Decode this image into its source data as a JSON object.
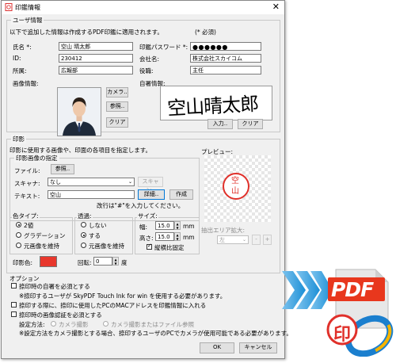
{
  "window": {
    "title": "印鑑情報",
    "close": "✕"
  },
  "user": {
    "group": "ユーザ情報",
    "instruction": "以下で追加した情報は作成するPDF印鑑に適用されます。",
    "required_note": "(* 必須)",
    "name_label": "氏名 *:",
    "name_value": "空山 晴太郎",
    "password_label": "印鑑パスワード *:",
    "password_value": "●●●●●●",
    "id_label": "ID:",
    "id_value": "230412",
    "company_label": "会社名:",
    "company_value": "株式会社スカイコム",
    "dept_label": "所属:",
    "dept_value": "広報部",
    "title_label": "役職:",
    "title_value": "主任",
    "image_label": "画像情報:",
    "camera_btn": "カメラ..",
    "browse_btn": "参照..",
    "clear_btn": "クリア",
    "signature_label": "自署情報:",
    "signature_text": "空山晴太郎",
    "input_btn": "入力..",
    "sig_clear_btn": "クリア"
  },
  "seal": {
    "group": "印影",
    "instruction": "印影に使用する画像や、印面の各項目を指定します。",
    "spec_group": "印影画像の指定",
    "file_label": "ファイル:",
    "file_browse": "参照..",
    "scanner_label": "スキャナ:",
    "scanner_value": "なし",
    "scan_btn": "スキャン..",
    "text_label": "テキスト:",
    "text_value": "空山",
    "detail_btn": "詳細..",
    "create_btn": "作成",
    "newline_note": "改行は\"#\"を入力してください。",
    "preview_label": "プレビュー:",
    "preview_text": "空山",
    "extract_label": "抽出エリア拡大:",
    "extract_value": "左",
    "extract_minus": "-",
    "extract_plus": "+",
    "color_type_label": "色タイプ:",
    "color_opts": [
      "2値",
      "グラデーション",
      "元画像を維持"
    ],
    "transparent_label": "透過:",
    "transparent_opts": [
      "しない",
      "する",
      "元画像を維持"
    ],
    "size_label": "サイズ:",
    "width_label": "幅:",
    "width_value": "15.0",
    "width_unit": "mm",
    "height_label": "高さ:",
    "height_value": "15.0",
    "height_unit": "mm",
    "aspect_label": "縦横比固定",
    "seal_color_label": "印影色:",
    "seal_color": "#e8372c",
    "rotation_label": "回転:",
    "rotation_value": "0",
    "rotation_unit": "度"
  },
  "options": {
    "group": "オプション",
    "opt1": "捺印時の自署を必須とする",
    "opt1_note": "※捺印するユーザが SkyPDF Touch Ink for win を使用する必要があります。",
    "opt2": "捺印する際に、捺印に使用したPCのMACアドレスを印鑑情報に入れる",
    "opt3": "捺印時の画像認証を必須とする",
    "method_label": "設定方法:",
    "method_opts": [
      "カメラ撮影",
      "カメラ撮影またはファイル参照"
    ],
    "opt3_note": "※設定方法をカメラ撮影とする場合、捺印するユーザのPCでカメラが使用可能である必要があります。"
  },
  "footer": {
    "ok": "OK",
    "cancel": "キャンセル"
  },
  "logo": {
    "text": "PDF",
    "seal_char": "印"
  },
  "colors": {
    "arrow": "#1b8fd6",
    "logo_red": "#e8371d",
    "seal_red": "#e0302a"
  }
}
